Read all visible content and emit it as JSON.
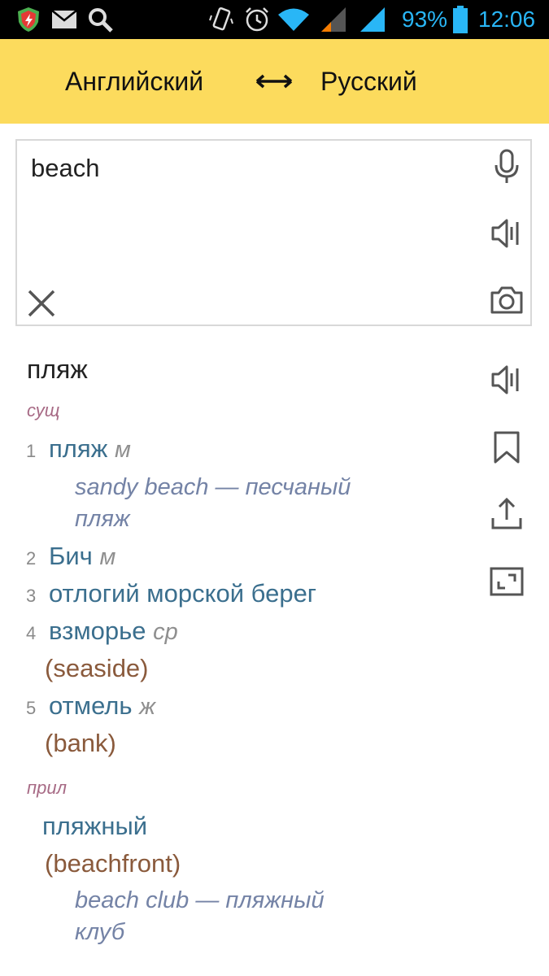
{
  "status_bar": {
    "battery_percent": "93%",
    "time": "12:06",
    "icons": [
      "shield-app-icon",
      "mail-icon",
      "search-icon",
      "vibrate-icon",
      "alarm-icon",
      "wifi-icon",
      "signal-weak-icon",
      "signal-icon",
      "battery-icon"
    ]
  },
  "header": {
    "source_lang": "Английский",
    "swap_symbol": "↔",
    "target_lang": "Русский",
    "background": "#fcdb5d"
  },
  "input": {
    "text": "beach",
    "icons": [
      "microphone-icon",
      "speaker-icon",
      "camera-icon",
      "clear-icon"
    ]
  },
  "result": {
    "headword": "пляж",
    "noun_section": {
      "pos": "сущ",
      "meanings": [
        {
          "num": "1",
          "text": "пляж",
          "gender": "м",
          "example": [
            "sandy beach — песчаный",
            "пляж"
          ]
        },
        {
          "num": "2",
          "text": "Бич",
          "gender": "м"
        },
        {
          "num": "3",
          "text": "отлогий морской берег"
        },
        {
          "num": "4",
          "text": "взморье",
          "gender": "ср",
          "synonym": "(seaside)"
        },
        {
          "num": "5",
          "text": "отмель",
          "gender": "ж",
          "synonym": "(bank)"
        }
      ]
    },
    "adj_section": {
      "pos": "прил",
      "text": "пляжный",
      "synonym": "(beachfront)",
      "example": [
        "beach club — пляжный",
        "клуб"
      ]
    },
    "side_icons": [
      "speaker-icon",
      "bookmark-icon",
      "share-icon",
      "fullscreen-icon"
    ]
  }
}
